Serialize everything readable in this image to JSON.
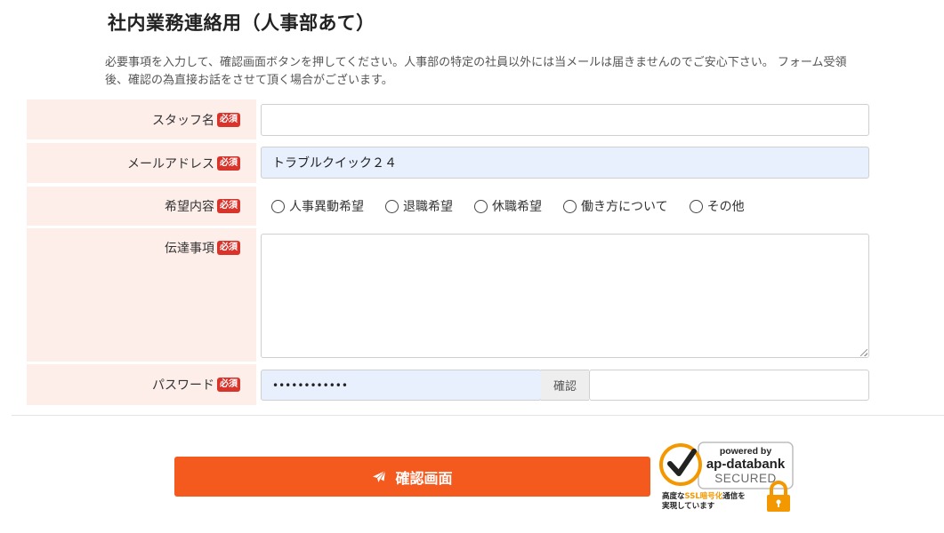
{
  "page": {
    "title": "社内業務連絡用（人事部あて）",
    "description": "必要事項を入力して、確認画面ボタンを押してください。人事部の特定の社員以外には当メールは届きませんのでご安心下さい。 フォーム受領後、確認の為直接お話をさせて頂く場合がございます。"
  },
  "form": {
    "required_label": "必須",
    "staff_name": {
      "label": "スタッフ名",
      "value": ""
    },
    "email": {
      "label": "メールアドレス",
      "value": "トラブルクイック２４"
    },
    "request": {
      "label": "希望内容",
      "options": [
        "人事異動希望",
        "退職希望",
        "休職希望",
        "働き方について",
        "その他"
      ]
    },
    "message": {
      "label": "伝達事項",
      "value": ""
    },
    "password": {
      "label": "パスワード",
      "value": "••••••••••••",
      "confirm_label": "確認",
      "confirm_value": ""
    }
  },
  "submit": {
    "label": "確認画面",
    "icon": "paper-plane-icon"
  },
  "security_badge": {
    "line1": "powered by",
    "line2": "ap-databank",
    "line3": "SECURED",
    "caption_pre": "高度な",
    "caption_highlight": "SSL暗号化",
    "caption_post": "通信を",
    "caption_line2": "実現しています",
    "colors": {
      "orange": "#f39800",
      "dark": "#222222",
      "gray": "#6b6b6b"
    }
  },
  "colors": {
    "label_bg": "#fdeeea",
    "required_badge": "#d9342b",
    "autofill_bg": "#e8f0fe",
    "submit_bg": "#f4591e"
  }
}
